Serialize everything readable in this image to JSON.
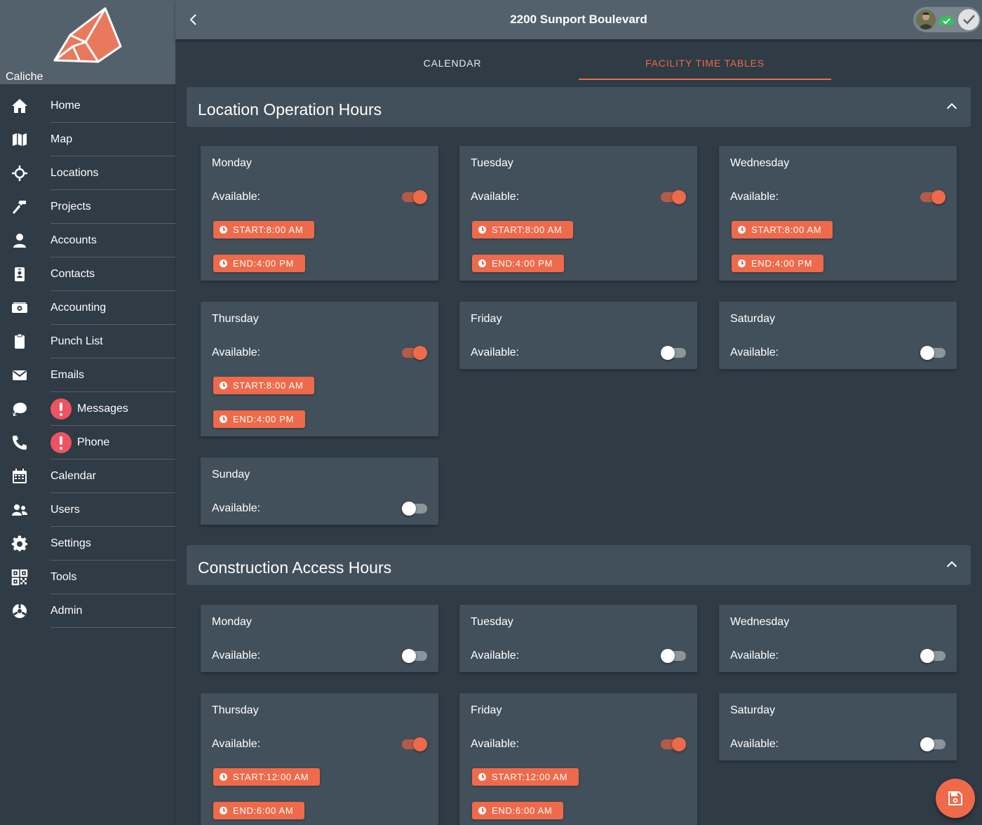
{
  "app": {
    "name": "Caliche",
    "brand_color": "#ee6a4a"
  },
  "header": {
    "title": "2200 Sunport Boulevard",
    "back_icon": "chevron-left-icon",
    "status_icons": [
      "avatar",
      "cloud-check-icon",
      "check-circle-icon"
    ]
  },
  "sidebar": {
    "items": [
      {
        "label": "Home",
        "icon": "home-icon"
      },
      {
        "label": "Map",
        "icon": "map-icon"
      },
      {
        "label": "Locations",
        "icon": "crosshair-icon"
      },
      {
        "label": "Projects",
        "icon": "hammer-icon"
      },
      {
        "label": "Accounts",
        "icon": "user-icon"
      },
      {
        "label": "Contacts",
        "icon": "contact-card-icon"
      },
      {
        "label": "Accounting",
        "icon": "money-icon"
      },
      {
        "label": "Punch List",
        "icon": "clipboard-icon"
      },
      {
        "label": "Emails",
        "icon": "envelope-icon"
      },
      {
        "label": "Messages",
        "icon": "chat-icon",
        "alert": true
      },
      {
        "label": "Phone",
        "icon": "phone-icon",
        "alert": true
      },
      {
        "label": "Calendar",
        "icon": "calendar-icon"
      },
      {
        "label": "Users",
        "icon": "users-icon"
      },
      {
        "label": "Settings",
        "icon": "gear-icon"
      },
      {
        "label": "Tools",
        "icon": "qr-code-icon"
      },
      {
        "label": "Admin",
        "icon": "admin-icon"
      }
    ]
  },
  "tabs": [
    {
      "label": "CALENDAR",
      "active": false
    },
    {
      "label": "FACILITY TIME TABLES",
      "active": true
    }
  ],
  "labels": {
    "available": "Available:"
  },
  "sections": [
    {
      "title": "Location Operation Hours",
      "days": [
        {
          "day": "Monday",
          "available": true,
          "start": "START:8:00 AM",
          "end": "END:4:00 PM"
        },
        {
          "day": "Tuesday",
          "available": true,
          "start": "START:8:00 AM",
          "end": "END:4:00 PM"
        },
        {
          "day": "Wednesday",
          "available": true,
          "start": "START:8:00 AM",
          "end": "END:4:00 PM"
        },
        {
          "day": "Thursday",
          "available": true,
          "start": "START:8:00 AM",
          "end": "END:4:00 PM"
        },
        {
          "day": "Friday",
          "available": false
        },
        {
          "day": "Saturday",
          "available": false
        },
        {
          "day": "Sunday",
          "available": false
        }
      ]
    },
    {
      "title": "Construction Access Hours",
      "days": [
        {
          "day": "Monday",
          "available": false
        },
        {
          "day": "Tuesday",
          "available": false
        },
        {
          "day": "Wednesday",
          "available": false
        },
        {
          "day": "Thursday",
          "available": true,
          "start": "START:12:00 AM",
          "end": "END:6:00 AM"
        },
        {
          "day": "Friday",
          "available": true,
          "start": "START:12:00 AM",
          "end": "END:6:00 AM"
        },
        {
          "day": "Saturday",
          "available": false
        }
      ]
    }
  ],
  "fab": {
    "icon": "save-icon"
  }
}
